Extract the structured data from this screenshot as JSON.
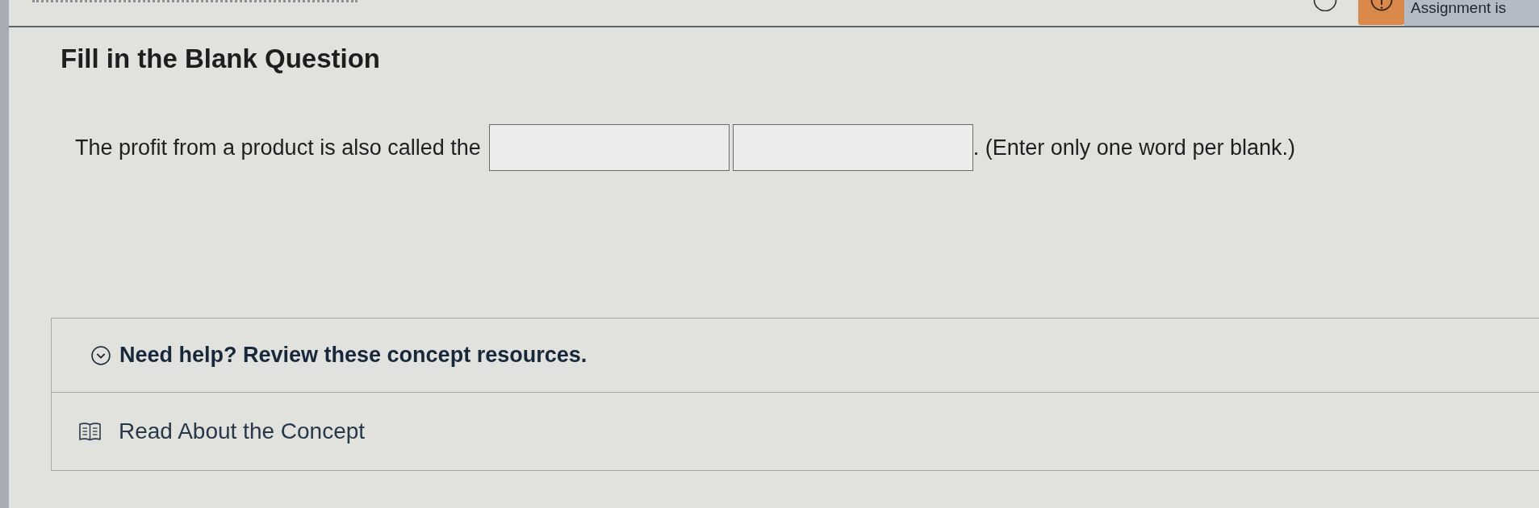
{
  "top_bar": {
    "notice": "Assignment is"
  },
  "question": {
    "heading": "Fill in the Blank Question",
    "segments": [
      {
        "kind": "text",
        "text": "The profit from a product is also called the"
      },
      {
        "kind": "blank"
      },
      {
        "kind": "blank"
      },
      {
        "kind": "text",
        "text": ". (Enter only one word per blank.)"
      }
    ]
  },
  "help": {
    "title": "Need help? Review these concept resources.",
    "expanded": true,
    "resources": [
      {
        "label": "Read About the Concept"
      }
    ]
  }
}
